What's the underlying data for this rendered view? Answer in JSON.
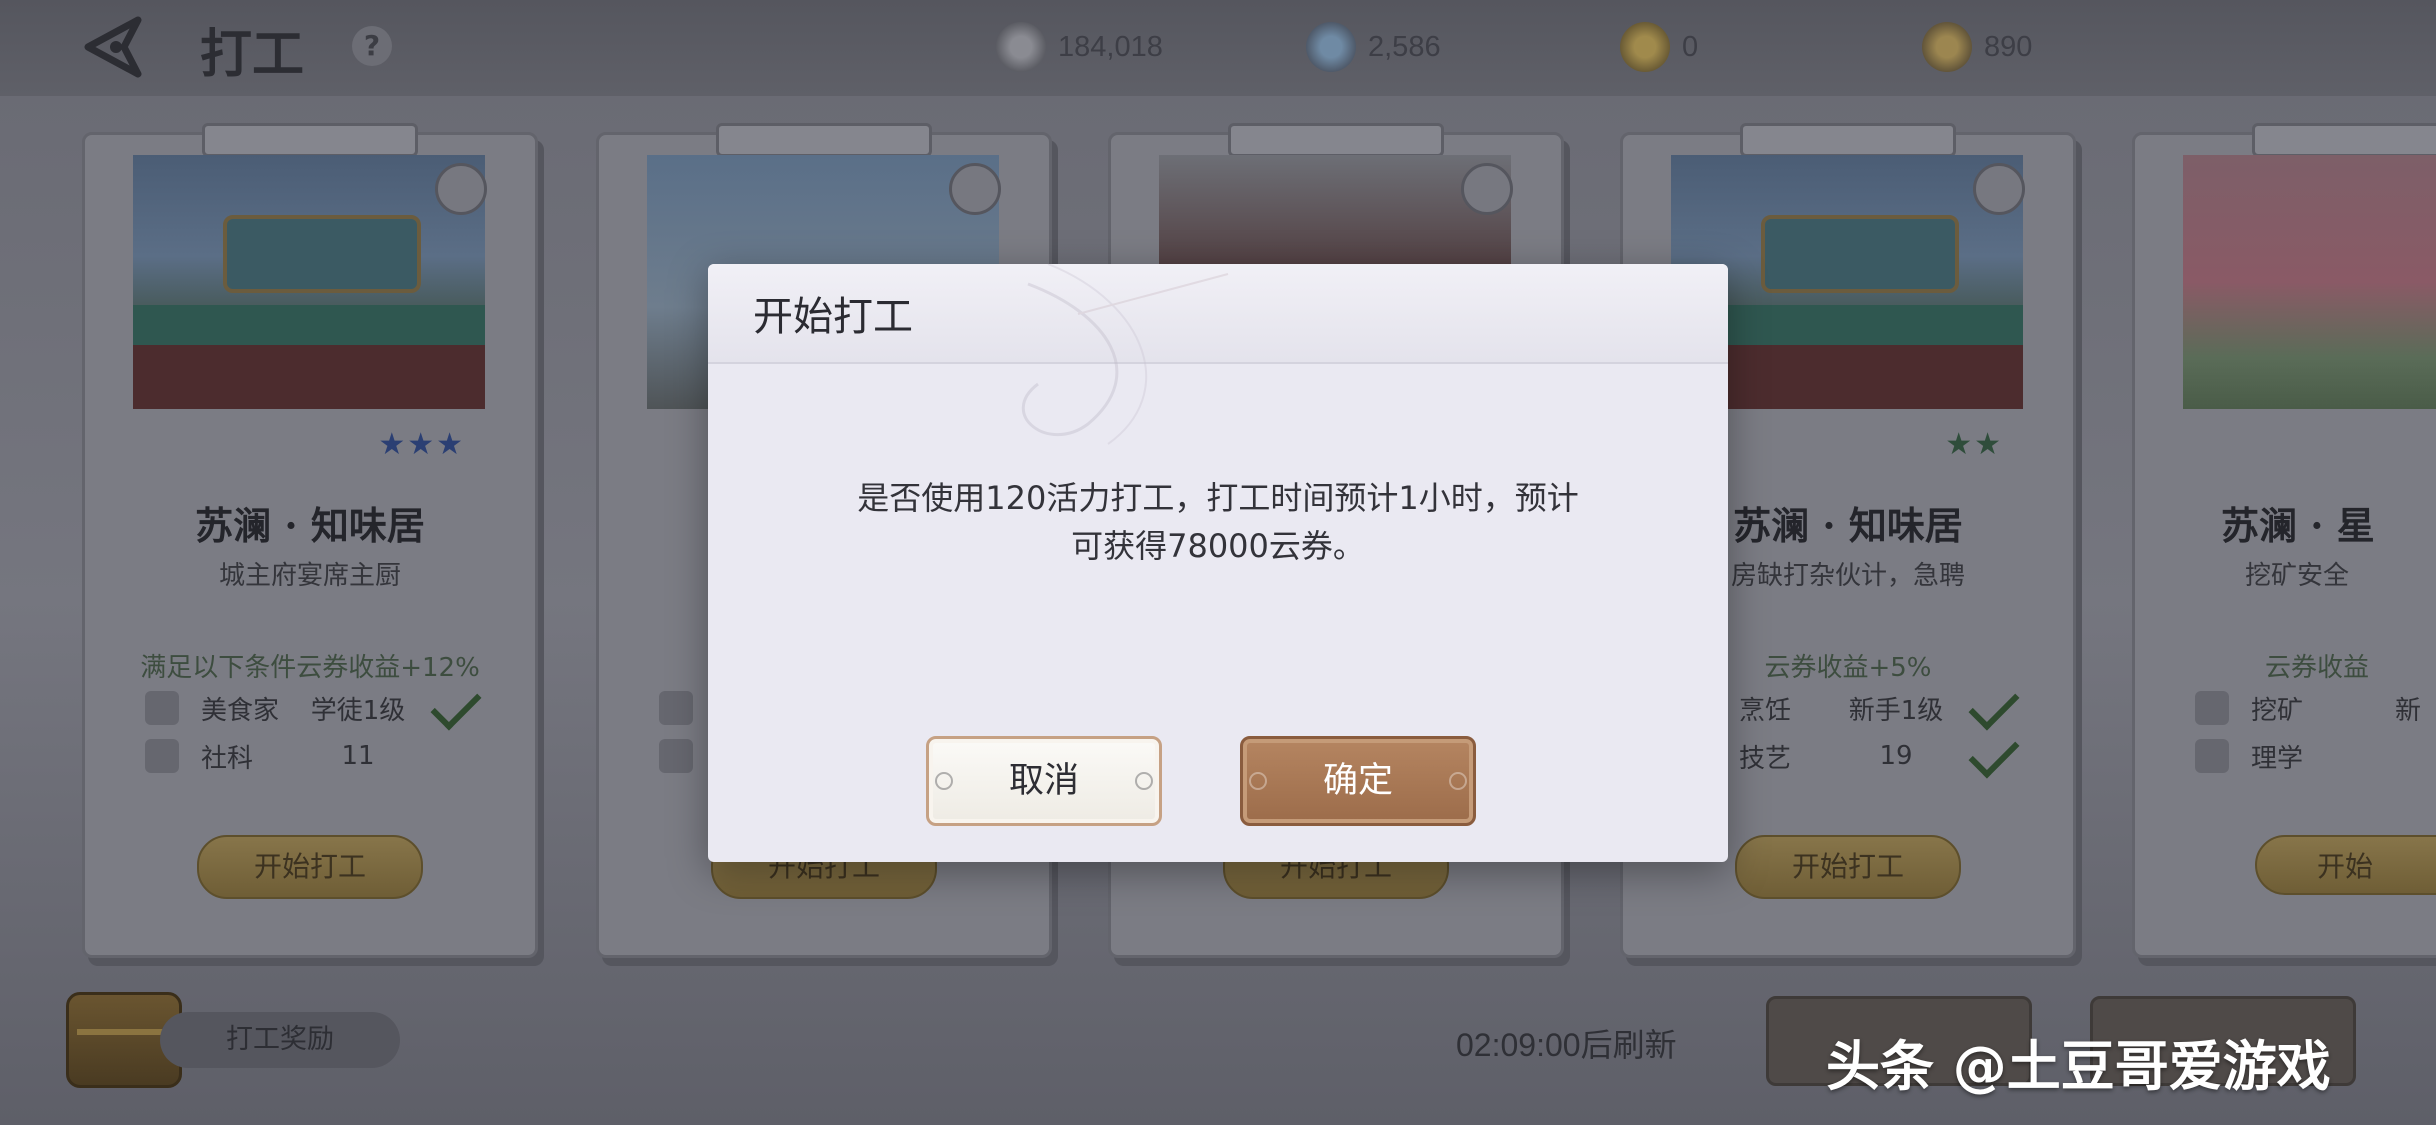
{
  "header": {
    "title": "打工",
    "help": "?",
    "currencies": [
      {
        "icon": "silver-coin-icon",
        "value": "184,018"
      },
      {
        "icon": "gem-icon",
        "value": "2,586"
      },
      {
        "icon": "gold-coin-icon",
        "value": "0"
      },
      {
        "icon": "token-icon",
        "value": "890"
      }
    ]
  },
  "cards": [
    {
      "title": "苏澜 · 知味居",
      "subtitle": "城主府宴席主厨",
      "condition": "满足以下条件云券收益+12%",
      "req1": {
        "name": "美食家",
        "level": "学徒1级"
      },
      "req2": {
        "name": "社科",
        "level": "11"
      },
      "button": "开始打工"
    },
    {
      "button": "开始打工"
    },
    {
      "button": "开始打工"
    },
    {
      "title": "苏澜 · 知味居",
      "subtitle": "房缺打杂伙计，急聘",
      "condition": "云券收益+5%",
      "req1": {
        "name": "烹饪",
        "level": "新手1级"
      },
      "req2": {
        "name": "技艺",
        "level": "19"
      },
      "button": "开始打工"
    },
    {
      "title": "苏澜 · 星",
      "subtitle": "挖矿安全",
      "condition": "云券收益",
      "req1": {
        "name": "挖矿",
        "level": "新"
      },
      "req2": {
        "name": "理学",
        "level": ""
      },
      "button": "开始"
    }
  ],
  "footer": {
    "reward_label": "打工奖励",
    "refresh_text": "02:09:00后刷新"
  },
  "dialog": {
    "title": "开始打工",
    "message_line1": "是否使用120活力打工，打工时间预计1小时，预计",
    "message_line2": "可获得78000云券。",
    "cancel_label": "取消",
    "confirm_label": "确定"
  },
  "watermark": "头条 @土豆哥爱游戏"
}
